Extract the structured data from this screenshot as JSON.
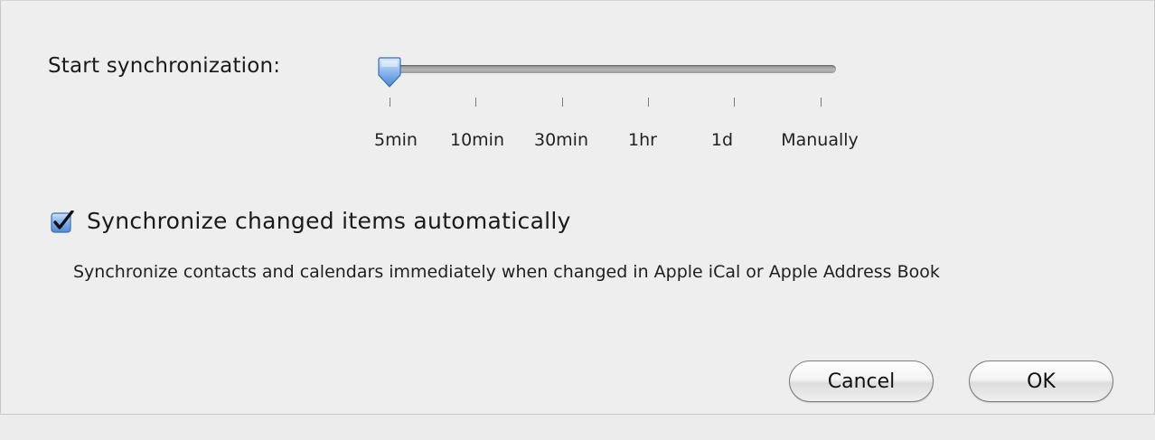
{
  "sync": {
    "label": "Start synchronization:",
    "slider": {
      "options": [
        "5min",
        "10min",
        "30min",
        "1hr",
        "1d",
        "Manually"
      ],
      "selected_index": 0,
      "selected_value": "5min"
    }
  },
  "auto_sync": {
    "checked": true,
    "label": "Synchronize changed items automatically",
    "description": "Synchronize contacts and calendars immediately when changed in Apple iCal or Apple Address Book"
  },
  "buttons": {
    "cancel_label": "Cancel",
    "ok_label": "OK"
  },
  "colors": {
    "accent": "#3b82d9",
    "background": "#eeeeee"
  }
}
